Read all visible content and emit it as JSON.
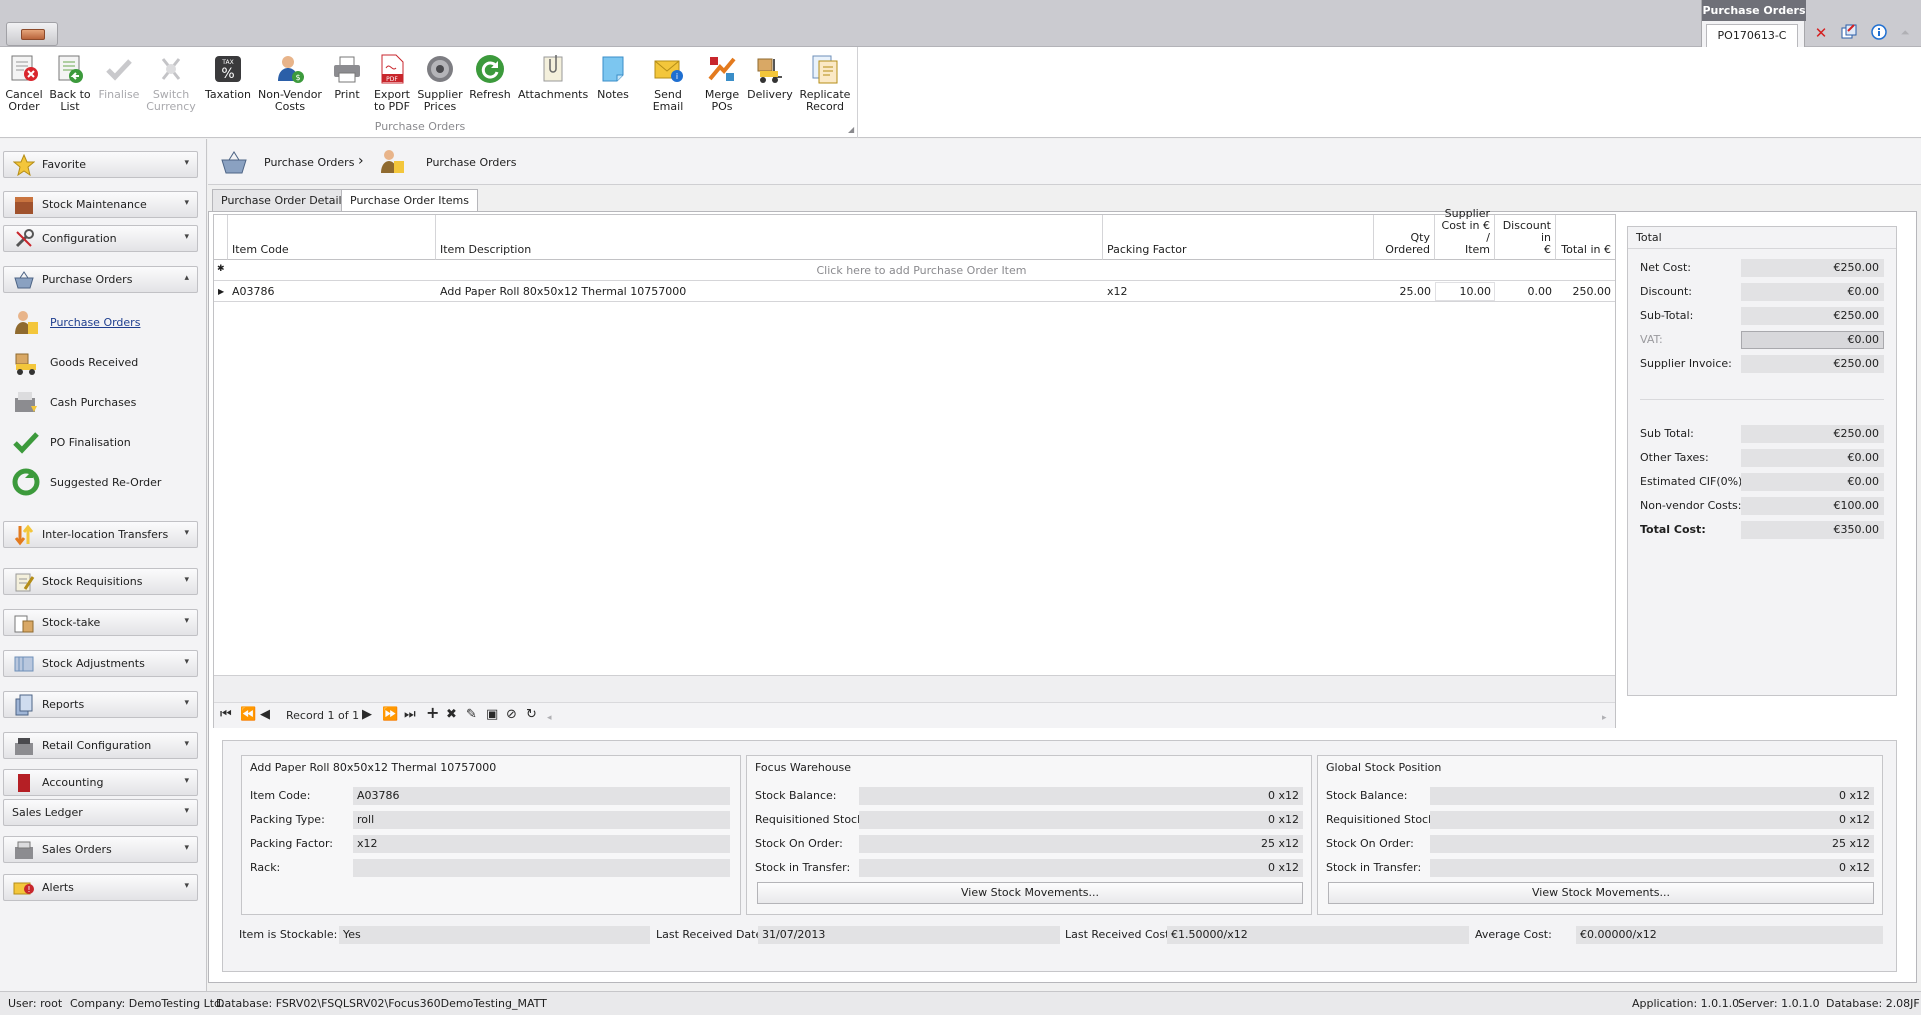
{
  "window": {
    "context_group_title": "Purchase Orders",
    "record_tab": "PO170613-C"
  },
  "ribbon": {
    "group_label": "Purchase Orders",
    "buttons": [
      {
        "l1": "Cancel",
        "l2": "Order",
        "icon": "cancel-order-icon"
      },
      {
        "l1": "Back to",
        "l2": "List",
        "icon": "back-to-list-icon"
      },
      {
        "l1": "Finalise",
        "l2": "",
        "icon": "finalise-icon"
      },
      {
        "l1": "Switch",
        "l2": "Currency",
        "icon": "switch-currency-icon"
      },
      {
        "l1": "Taxation",
        "l2": "",
        "icon": "taxation-icon"
      },
      {
        "l1": "Non-Vendor",
        "l2": "Costs",
        "icon": "non-vendor-costs-icon"
      },
      {
        "l1": "Print",
        "l2": "",
        "icon": "printer-icon"
      },
      {
        "l1": "Export",
        "l2": "to PDF",
        "icon": "pdf-icon"
      },
      {
        "l1": "Supplier",
        "l2": "Prices",
        "icon": "supplier-prices-icon"
      },
      {
        "l1": "Refresh",
        "l2": "",
        "icon": "refresh-icon"
      },
      {
        "l1": "Attachments",
        "l2": "",
        "icon": "attachments-icon"
      },
      {
        "l1": "Notes",
        "l2": "",
        "icon": "notes-icon"
      },
      {
        "l1": "Send Email",
        "l2": "",
        "icon": "email-icon"
      },
      {
        "l1": "Merge",
        "l2": "POs",
        "icon": "merge-icon"
      },
      {
        "l1": "Delivery",
        "l2": "",
        "icon": "delivery-icon"
      },
      {
        "l1": "Replicate",
        "l2": "Record",
        "icon": "replicate-icon"
      }
    ]
  },
  "sidebar": {
    "favorite": "Favorite",
    "stock_maintenance": "Stock Maintenance",
    "configuration": "Configuration",
    "purchase_orders": "Purchase Orders",
    "sub_items": [
      "Purchase Orders",
      "Goods Received",
      "Cash Purchases",
      "PO Finalisation",
      "Suggested Re-Order"
    ],
    "inter_location": "Inter-location Transfers",
    "stock_requisitions": "Stock Requisitions",
    "stock_take": "Stock-take",
    "stock_adjustments": "Stock Adjustments",
    "reports": "Reports",
    "retail_configuration": "Retail Configuration",
    "accounting": "Accounting",
    "sales_ledger": "Sales Ledger",
    "sales_orders": "Sales Orders",
    "alerts": "Alerts"
  },
  "breadcrumb": {
    "first": "Purchase Orders",
    "second": "Purchase Orders",
    "separator": "›"
  },
  "tabs": {
    "details": "Purchase Order Details",
    "items": "Purchase Order Items"
  },
  "grid": {
    "columns": {
      "item_code": "Item Code",
      "item_description": "Item Description",
      "packing_factor": "Packing Factor",
      "qty_1": "Qty",
      "qty_2": "Ordered",
      "supplier_1": "Supplier",
      "supplier_2": "Cost in € /",
      "supplier_3": "Item",
      "discount_1": "Discount in",
      "discount_2": "€",
      "total": "Total in €"
    },
    "new_row_marker": "✱",
    "new_row_text": "Click here to add Purchase Order Item",
    "rows": [
      {
        "code": "A03786",
        "description": "Add Paper Roll 80x50x12 Thermal 10757000",
        "packing_factor": "x12",
        "qty": "25.00",
        "cost": "10.00",
        "discount": "0.00",
        "total": "250.00"
      }
    ],
    "record_text": "Record 1 of 1"
  },
  "totals": {
    "title": "Total",
    "net_cost_label": "Net Cost:",
    "net_cost": "€250.00",
    "discount_label": "Discount:",
    "discount": "€0.00",
    "subtotal_label": "Sub-Total:",
    "subtotal": "€250.00",
    "vat_label": "VAT:",
    "vat": "€0.00",
    "supplier_invoice_label": "Supplier Invoice:",
    "supplier_invoice": "€250.00",
    "sub_total_label": "Sub Total:",
    "sub_total": "€250.00",
    "other_taxes_label": "Other Taxes:",
    "other_taxes": "€0.00",
    "cif_label": "Estimated CIF(0%):",
    "cif": "€0.00",
    "non_vendor_label": "Non-vendor Costs:",
    "non_vendor": "€100.00",
    "total_cost_label": "Total Cost:",
    "total_cost": "€350.00"
  },
  "item_panel": {
    "title": "Add Paper Roll 80x50x12 Thermal 10757000",
    "item_code_label": "Item Code:",
    "item_code": "A03786",
    "packing_type_label": "Packing Type:",
    "packing_type": "roll",
    "packing_factor_label": "Packing Factor:",
    "packing_factor": "x12",
    "rack_label": "Rack:",
    "rack": ""
  },
  "warehouse_panel": {
    "title": "Focus Warehouse",
    "balance_label": "Stock Balance:",
    "balance": "0 x12",
    "requisitioned_label": "Requisitioned Stock:",
    "requisitioned": "0 x12",
    "on_order_label": "Stock On Order:",
    "on_order": "25 x12",
    "in_transfer_label": "Stock in Transfer:",
    "in_transfer": "0 x12",
    "button": "View Stock Movements..."
  },
  "global_panel": {
    "title": "Global Stock Position",
    "balance_label": "Stock Balance:",
    "balance": "0 x12",
    "requisitioned_label": "Requisitioned Stock:",
    "requisitioned": "0 x12",
    "on_order_label": "Stock On Order:",
    "on_order": "25 x12",
    "in_transfer_label": "Stock in Transfer:",
    "in_transfer": "0 x12",
    "button": "View Stock Movements..."
  },
  "footer_info": {
    "stockable_label": "Item is Stockable:",
    "stockable": "Yes",
    "last_date_label": "Last Received Date:",
    "last_date": "31/07/2013",
    "last_cost_label": "Last Received Cost:",
    "last_cost": "€1.50000/x12",
    "avg_cost_label": "Average Cost:",
    "avg_cost": "€0.00000/x12"
  },
  "status": {
    "user": "User: root",
    "company": "Company: DemoTesting Ltd.",
    "database": "Database: FSRV02\\FSQLSRV02\\Focus360DemoTesting_MATT",
    "application": "Application: 1.0.1.0",
    "server": "Server: 1.0.1.0",
    "db_version": "Database: 2.08JF"
  }
}
